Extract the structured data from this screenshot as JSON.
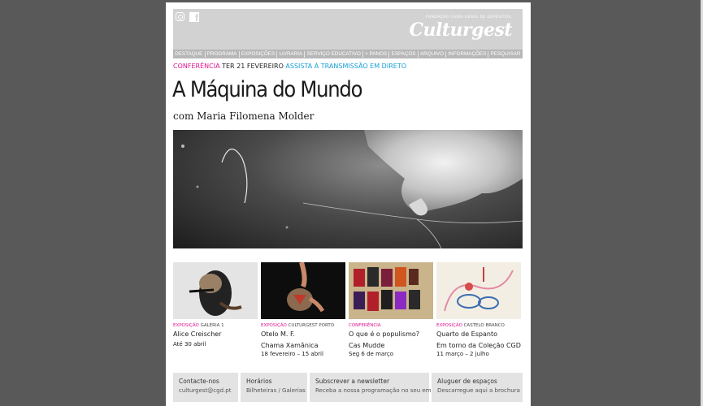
{
  "header": {
    "tagline": "FUNDAÇÃO CAIXA GERAL DE DEPÓSITOS",
    "logo": "Culturgest",
    "icons": [
      "instagram-icon",
      "facebook-icon"
    ]
  },
  "nav": {
    "items": [
      "DESTAQUE",
      "PROGRAMA",
      "EXPOSIÇÕES",
      "LIVRARIA",
      "SERVIÇO EDUCATIVO",
      "+ PANOS",
      "ESPAÇOS",
      "ARQUIVO",
      "INFORMAÇÕES",
      "PESQUISAR"
    ]
  },
  "event": {
    "type": "CONFERÊNCIA",
    "date": "TER 21 FEVEREIRO",
    "link": "ASSISTA À TRANSMISSÃO EM DIRETO",
    "title": "A Máquina do Mundo",
    "subtitle": "com Maria Filomena Molder"
  },
  "cards": [
    {
      "type": "EXPOSIÇÃO",
      "place": "GALERIA 1",
      "title1": "Alice Creischer",
      "title2": "",
      "dates": "Até 30 abril"
    },
    {
      "type": "EXPOSIÇÃO",
      "place": "CULTURGEST PORTO",
      "title1": "Otelo M. F.",
      "title2": "Chama Xamânica",
      "dates": "18 fevereiro – 15 abril"
    },
    {
      "type": "CONFERÊNCIA",
      "place": "",
      "title1": "O que é o populismo?",
      "title2": "Cas Mudde",
      "dates": "Seg 6 de março"
    },
    {
      "type": "EXPOSIÇÃO",
      "place": "CASTELO BRANCO",
      "title1": "Quarto de Espanto",
      "title2": "Em torno da Coleção CGD",
      "dates": "11 março – 2 julho"
    }
  ],
  "footer": [
    {
      "heading": "Contacte-nos",
      "sub": "culturgest@cgd.pt"
    },
    {
      "heading": "Horários",
      "sub": "Bilheteiras / Galerias"
    },
    {
      "heading": "Subscrever a newsletter",
      "sub": "Receba a nossa programação no seu email"
    },
    {
      "heading": "Aluguer de espaços",
      "sub": "Descarregue aqui a brochura"
    }
  ],
  "colors": {
    "accent_magenta": "#e0148e",
    "accent_blue": "#18a0d8",
    "header_gray": "#d2d2d2"
  }
}
